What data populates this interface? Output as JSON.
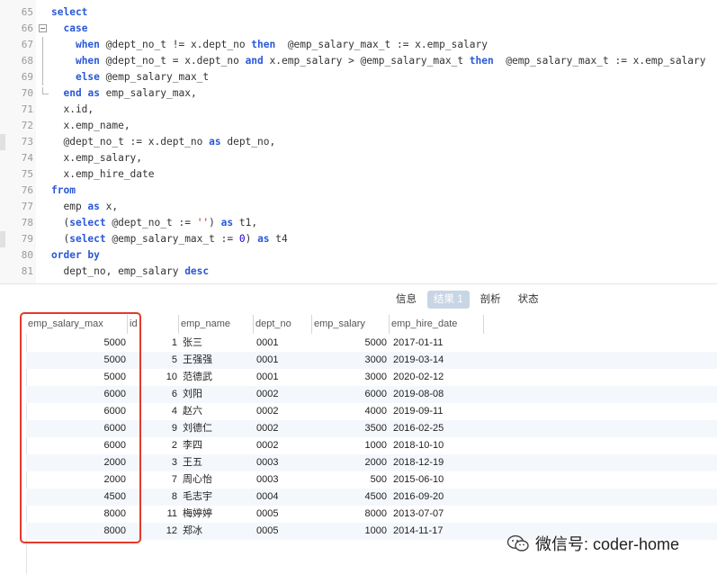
{
  "editor": {
    "lines": [
      {
        "no": "65",
        "html": "<span class=\"kw\">select</span>"
      },
      {
        "no": "66",
        "html": "  <span class=\"kw\">case</span>"
      },
      {
        "no": "67",
        "html": "    <span class=\"kw\">when</span> @dept_no_t != x.dept_no <span class=\"kw\">then</span>  @emp_salary_max_t := x.emp_salary"
      },
      {
        "no": "68",
        "html": "    <span class=\"kw\">when</span> @dept_no_t = x.dept_no <span class=\"kw\">and</span> x.emp_salary &gt; @emp_salary_max_t <span class=\"kw\">then</span>  @emp_salary_max_t := x.emp_salary"
      },
      {
        "no": "69",
        "html": "    <span class=\"kw\">else</span> @emp_salary_max_t"
      },
      {
        "no": "70",
        "html": "  <span class=\"kw\">end</span> <span class=\"kw\">as</span> emp_salary_max,"
      },
      {
        "no": "71",
        "html": "  x.id,"
      },
      {
        "no": "72",
        "html": "  x.emp_name,"
      },
      {
        "no": "73",
        "html": "  @dept_no_t := x.dept_no <span class=\"kw\">as</span> dept_no,"
      },
      {
        "no": "74",
        "html": "  x.emp_salary,"
      },
      {
        "no": "75",
        "html": "  x.emp_hire_date"
      },
      {
        "no": "76",
        "html": "<span class=\"kw\">from</span>"
      },
      {
        "no": "77",
        "html": "  emp <span class=\"kw\">as</span> x,"
      },
      {
        "no": "78",
        "html": "  (<span class=\"kw\">select</span> @dept_no_t := <span class=\"str\">''</span>) <span class=\"kw\">as</span> t1,"
      },
      {
        "no": "79",
        "html": "  (<span class=\"kw\">select</span> @emp_salary_max_t := <span class=\"num\">0</span>) <span class=\"kw\">as</span> t4"
      },
      {
        "no": "80",
        "html": "<span class=\"kw\">order by</span>"
      },
      {
        "no": "81",
        "html": "  dept_no, emp_salary <span class=\"kw\">desc</span>"
      }
    ]
  },
  "tabs": [
    {
      "label": "信息",
      "active": false
    },
    {
      "label": "结果 1",
      "active": true
    },
    {
      "label": "剖析",
      "active": false
    },
    {
      "label": "状态",
      "active": false
    }
  ],
  "result": {
    "columns": [
      "emp_salary_max",
      "id",
      "emp_name",
      "dept_no",
      "emp_salary",
      "emp_hire_date"
    ],
    "rows": [
      [
        "5000",
        "1",
        "张三",
        "0001",
        "5000",
        "2017-01-11"
      ],
      [
        "5000",
        "5",
        "王强强",
        "0001",
        "3000",
        "2019-03-14"
      ],
      [
        "5000",
        "10",
        "范德武",
        "0001",
        "3000",
        "2020-02-12"
      ],
      [
        "6000",
        "6",
        "刘阳",
        "0002",
        "6000",
        "2019-08-08"
      ],
      [
        "6000",
        "4",
        "赵六",
        "0002",
        "4000",
        "2019-09-11"
      ],
      [
        "6000",
        "9",
        "刘德仁",
        "0002",
        "3500",
        "2016-02-25"
      ],
      [
        "6000",
        "2",
        "李四",
        "0002",
        "1000",
        "2018-10-10"
      ],
      [
        "2000",
        "3",
        "王五",
        "0003",
        "2000",
        "2018-12-19"
      ],
      [
        "2000",
        "7",
        "周心怡",
        "0003",
        "500",
        "2015-06-10"
      ],
      [
        "4500",
        "8",
        "毛志宇",
        "0004",
        "4500",
        "2016-09-20"
      ],
      [
        "8000",
        "11",
        "梅婷婷",
        "0005",
        "8000",
        "2013-07-07"
      ],
      [
        "8000",
        "12",
        "郑冰",
        "0005",
        "1000",
        "2014-11-17"
      ]
    ]
  },
  "watermark": {
    "text": "微信号: coder-home"
  },
  "colors": {
    "keyword": "#2a59d8",
    "highlight": "#e5382c",
    "active_tab": "#c8d5e4"
  }
}
